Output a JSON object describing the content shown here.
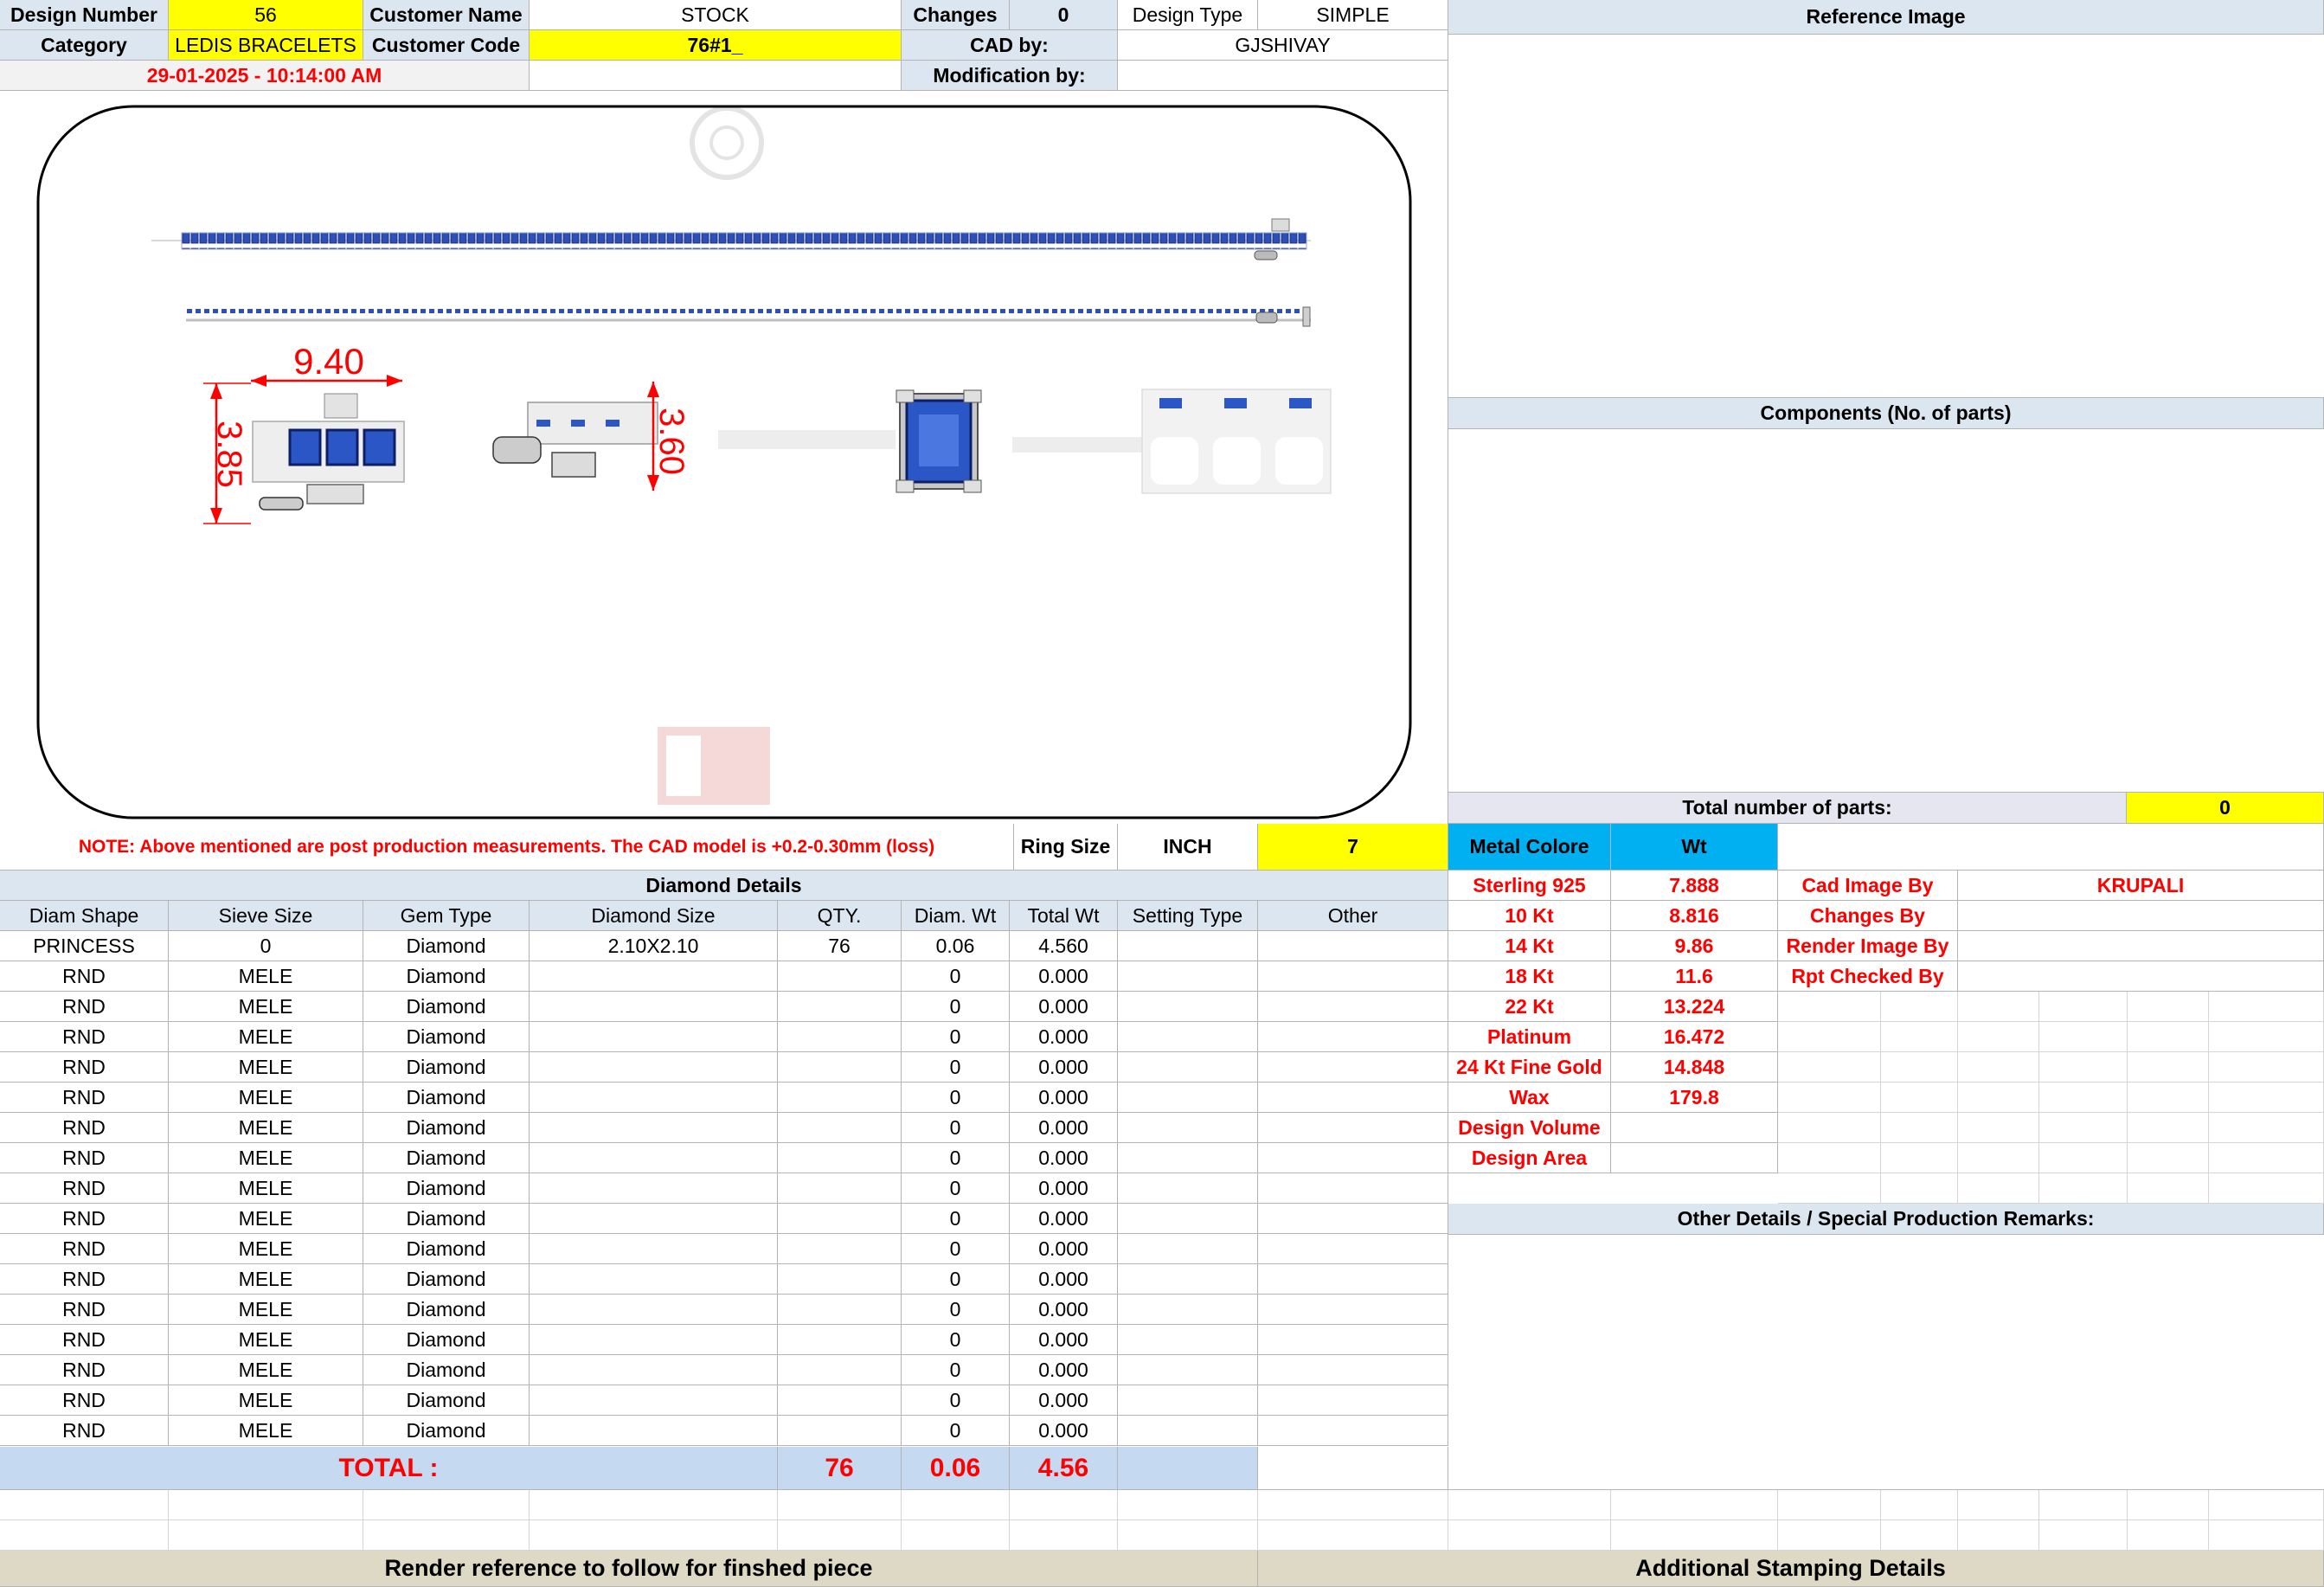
{
  "header": {
    "design_number_label": "Design Number",
    "design_number": "56",
    "customer_name_label": "Customer Name",
    "customer_name": "STOCK",
    "changes_label": "Changes",
    "changes": "0",
    "design_type_label": "Design Type",
    "design_type": "SIMPLE",
    "category_label": "Category",
    "category": "LEDIS BRACELETS",
    "customer_code_label": "Customer Code",
    "customer_code": "76#1_",
    "cad_by_label": "CAD by:",
    "cad_by": "GJSHIVAY",
    "timestamp": "29-01-2025 - 10:14:00 AM",
    "modification_by_label": "Modification by:"
  },
  "right_panel": {
    "reference_image_label": "Reference Image",
    "components_label": "Components (No. of parts)",
    "total_parts_label": "Total number of parts:",
    "total_parts": "0",
    "other_details_label": "Other Details / Special Production Remarks:"
  },
  "cad_drawing": {
    "dim_width": "9.40",
    "dim_height_left": "3.85",
    "dim_height_right": "3.60"
  },
  "note_row": {
    "note": "NOTE: Above mentioned are post production measurements. The CAD model is +0.2-0.30mm (loss)",
    "ring_size_label": "Ring Size",
    "ring_size_unit": "INCH",
    "ring_size": "7"
  },
  "metal": {
    "metal_color_label": "Metal Colore",
    "wt_label": "Wt",
    "rows": [
      {
        "name": "Sterling 925",
        "wt": "7.888"
      },
      {
        "name": "10 Kt",
        "wt": "8.816"
      },
      {
        "name": "14 Kt",
        "wt": "9.86"
      },
      {
        "name": "18 Kt",
        "wt": "11.6"
      },
      {
        "name": "22 Kt",
        "wt": "13.224"
      },
      {
        "name": "Platinum",
        "wt": "16.472"
      },
      {
        "name": "24 Kt Fine Gold",
        "wt": "14.848"
      },
      {
        "name": "Wax",
        "wt": "179.8"
      },
      {
        "name": "Design Volume",
        "wt": ""
      },
      {
        "name": "Design Area",
        "wt": ""
      }
    ]
  },
  "credits": {
    "cad_image_by_label": "Cad Image By",
    "cad_image_by": "KRUPALI",
    "changes_by_label": "Changes By",
    "render_image_by_label": "Render Image By",
    "rpt_checked_by_label": "Rpt Checked By"
  },
  "diamond_details": {
    "title": "Diamond Details",
    "columns": [
      "Diam Shape",
      "Sieve Size",
      "Gem Type",
      "Diamond Size",
      "QTY.",
      "Diam. Wt",
      "Total Wt",
      "Setting Type",
      "Other"
    ],
    "rows": [
      [
        "PRINCESS",
        "0",
        "Diamond",
        "2.10X2.10",
        "76",
        "0.06",
        "4.560",
        "",
        ""
      ],
      [
        "RND",
        "MELE",
        "Diamond",
        "",
        "",
        "0",
        "0.000",
        "",
        ""
      ],
      [
        "RND",
        "MELE",
        "Diamond",
        "",
        "",
        "0",
        "0.000",
        "",
        ""
      ],
      [
        "RND",
        "MELE",
        "Diamond",
        "",
        "",
        "0",
        "0.000",
        "",
        ""
      ],
      [
        "RND",
        "MELE",
        "Diamond",
        "",
        "",
        "0",
        "0.000",
        "",
        ""
      ],
      [
        "RND",
        "MELE",
        "Diamond",
        "",
        "",
        "0",
        "0.000",
        "",
        ""
      ],
      [
        "RND",
        "MELE",
        "Diamond",
        "",
        "",
        "0",
        "0.000",
        "",
        ""
      ],
      [
        "RND",
        "MELE",
        "Diamond",
        "",
        "",
        "0",
        "0.000",
        "",
        ""
      ],
      [
        "RND",
        "MELE",
        "Diamond",
        "",
        "",
        "0",
        "0.000",
        "",
        ""
      ],
      [
        "RND",
        "MELE",
        "Diamond",
        "",
        "",
        "0",
        "0.000",
        "",
        ""
      ],
      [
        "RND",
        "MELE",
        "Diamond",
        "",
        "",
        "0",
        "0.000",
        "",
        ""
      ],
      [
        "RND",
        "MELE",
        "Diamond",
        "",
        "",
        "0",
        "0.000",
        "",
        ""
      ],
      [
        "RND",
        "MELE",
        "Diamond",
        "",
        "",
        "0",
        "0.000",
        "",
        ""
      ],
      [
        "RND",
        "MELE",
        "Diamond",
        "",
        "",
        "0",
        "0.000",
        "",
        ""
      ],
      [
        "RND",
        "MELE",
        "Diamond",
        "",
        "",
        "0",
        "0.000",
        "",
        ""
      ],
      [
        "RND",
        "MELE",
        "Diamond",
        "",
        "",
        "0",
        "0.000",
        "",
        ""
      ],
      [
        "RND",
        "MELE",
        "Diamond",
        "",
        "",
        "0",
        "0.000",
        "",
        ""
      ]
    ],
    "total_label": "TOTAL :",
    "total_qty": "76",
    "total_diam_wt": "0.06",
    "total_wt": "4.56"
  },
  "footer": {
    "render_reference": "Render reference to follow for finshed piece",
    "additional_stamping": "Additional Stamping Details"
  }
}
